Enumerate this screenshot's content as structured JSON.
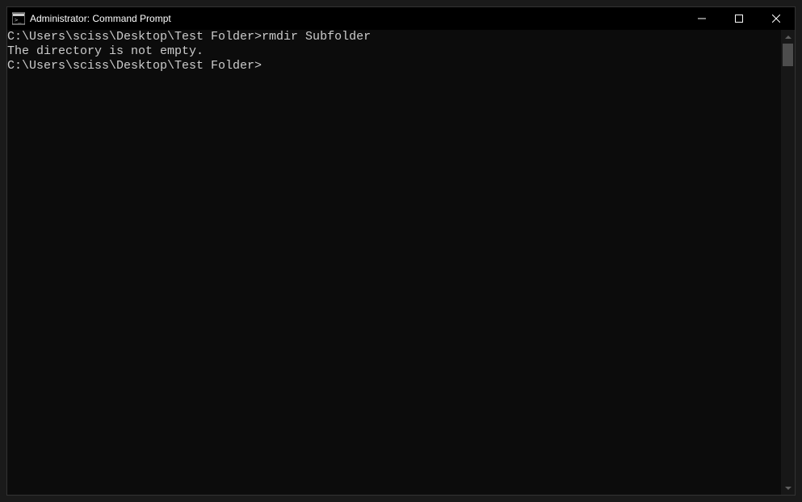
{
  "window": {
    "title": "Administrator: Command Prompt"
  },
  "terminal": {
    "lines": [
      "",
      "C:\\Users\\sciss\\Desktop\\Test Folder>rmdir Subfolder",
      "The directory is not empty.",
      "",
      "C:\\Users\\sciss\\Desktop\\Test Folder>"
    ]
  }
}
